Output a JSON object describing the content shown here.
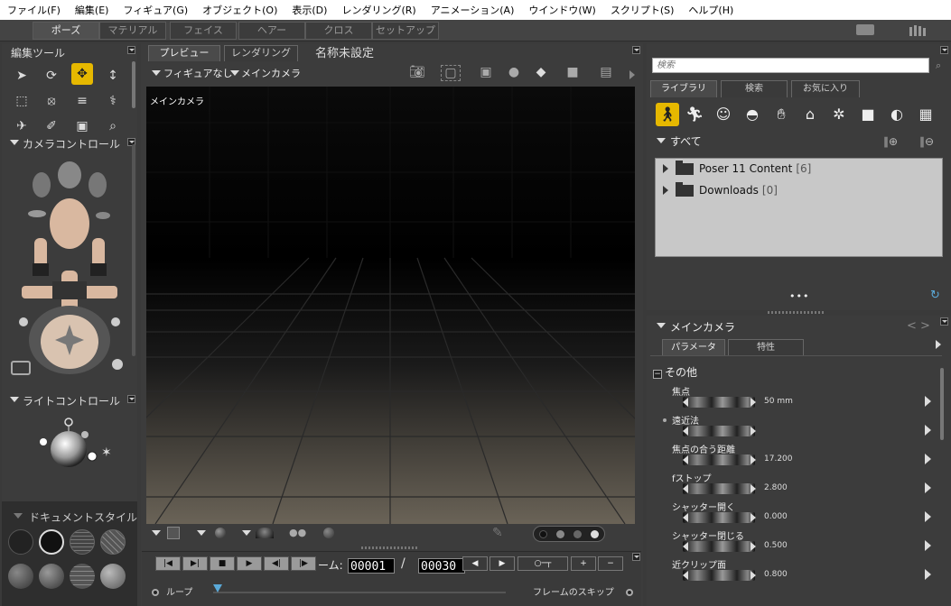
{
  "menubar": {
    "items": [
      "ファイル(F)",
      "編集(E)",
      "フィギュア(G)",
      "オブジェクト(O)",
      "表示(D)",
      "レンダリング(R)",
      "アニメーション(A)",
      "ウインドウ(W)",
      "スクリプト(S)",
      "ヘルプ(H)"
    ]
  },
  "room_tabs": [
    "ポーズ",
    "マテリアル",
    "フェイス",
    "ヘアー",
    "クロス",
    "セットアップ"
  ],
  "active_room": "ポーズ",
  "left_panel": {
    "tools_title": "編集ツール",
    "camera_control_title": "カメラコントロール",
    "light_control_title": "ライトコントロール",
    "document_style_title": "ドキュメントスタイル"
  },
  "document": {
    "tabs": [
      "プレビュー",
      "レンダリング"
    ],
    "title": "名称未設定",
    "figure_menu": "フィギュアなし",
    "camera_menu": "メインカメラ",
    "viewport_camera_label": "メインカメラ"
  },
  "playback": {
    "frame_label": "ーム:",
    "current_frame": "00001",
    "separator": "/",
    "total_frames": "00030",
    "loop_label": "ループ",
    "skip_frames_label": "フレームのスキップ"
  },
  "library": {
    "search_placeholder": "検索",
    "tabs": [
      "ライブラリ",
      "検索",
      "お気に入り"
    ],
    "category_title": "すべて",
    "folders": [
      {
        "name": "Poser 11 Content",
        "count": "[6]"
      },
      {
        "name": "Downloads",
        "count": "[0]"
      }
    ],
    "more": "•••"
  },
  "parameters": {
    "actor_title": "メインカメラ",
    "tabs": [
      "パラメータ",
      "特性"
    ],
    "group": "その他",
    "items": [
      {
        "label": "焦点",
        "value": "50 mm"
      },
      {
        "label": "遠近法",
        "value": ""
      },
      {
        "label": "焦点の合う距離",
        "value": "17.200"
      },
      {
        "label": "fストップ",
        "value": "2.800"
      },
      {
        "label": "シャッター開く",
        "value": "0.000"
      },
      {
        "label": "シャッター閉じる",
        "value": "0.500"
      },
      {
        "label": "近クリップ面",
        "value": "0.800"
      }
    ]
  },
  "colors": {
    "accent": "#e6b800",
    "panel_bg": "#3c3c3c",
    "library_list_bg": "#c8c8c8"
  }
}
